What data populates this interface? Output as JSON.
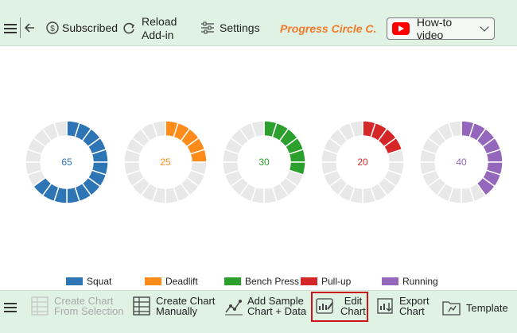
{
  "toolbar": {
    "subscribed": "Subscribed",
    "reload_line1": "Reload",
    "reload_line2": "Add-in",
    "settings": "Settings",
    "chart_title": "Progress Circle C...",
    "howto": "How-to video"
  },
  "colors": {
    "accent_title": "#f07a2a",
    "bar_bg": "#dff2e4",
    "empty_segment": "#e8e8e8",
    "highlight_border": "#d0141c"
  },
  "chart_data": {
    "type": "progress-circle",
    "segments_per_ring": 20,
    "max": 100,
    "series": [
      {
        "name": "Squat",
        "value": 65,
        "color": "#2e75b6"
      },
      {
        "name": "Deadlift",
        "value": 25,
        "color": "#ff8c1a"
      },
      {
        "name": "Bench Press",
        "value": 30,
        "color": "#2ca02c"
      },
      {
        "name": "Pull-up",
        "value": 20,
        "color": "#d62728"
      },
      {
        "name": "Running",
        "value": 40,
        "color": "#9467bd"
      }
    ],
    "legend_position": "bottom"
  },
  "bottom": {
    "create_sel_1": "Create Chart",
    "create_sel_2": "From Selection",
    "create_man_1": "Create Chart",
    "create_man_2": "Manually",
    "add_sample_1": "Add Sample",
    "add_sample_2": "Chart + Data",
    "edit_1": "Edit",
    "edit_2": "Chart",
    "export_1": "Export",
    "export_2": "Chart",
    "template": "Template"
  }
}
